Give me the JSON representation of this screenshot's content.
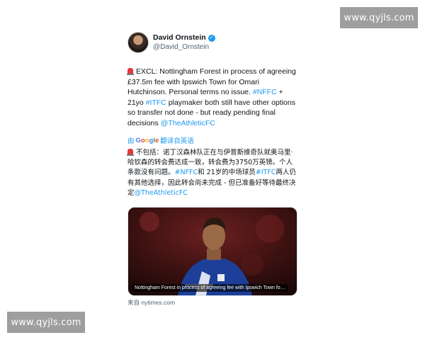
{
  "watermark": {
    "top_text": "www.qyjls.com",
    "bottom_text": "www.qyjls.com"
  },
  "tweet": {
    "author_name": "David Ornstein",
    "handle": "@David_Ornstein",
    "verified": true,
    "body_en": {
      "part1": "EXCL: Nottingham Forest in process of agreeing £37.5m fee with Ipswich Town for Omari Hutchinson. Personal terms no issue. ",
      "hashtag1": "#NFFC",
      "part2": " + 21yo ",
      "hashtag2": "#ITFC",
      "part3": " playmaker both still have other options so transfer not done - but ready pending final decisions ",
      "mention": "@TheAthleticFC"
    },
    "translate": {
      "prefix": "由",
      "google": [
        "G",
        "o",
        "o",
        "g",
        "l",
        "e"
      ],
      "suffix": "翻译自英语"
    },
    "body_zh": {
      "part1": "不包括：诺丁汉森林队正在与伊普斯维奇队就奥马里·哈钦森的转会费达成一致，转会费为3750万英镑。个人条款没有问题。",
      "hashtag1": "#NFFC",
      "part2": "和 21岁的中场球员",
      "hashtag2": "#ITFC",
      "part3": "两人仍有其他选择，因此转会尚未完成 - 但已准备好等待最终决定",
      "mention": "@TheAthleticFC"
    },
    "media": {
      "caption": "Nottingham Forest in process of agreeing fee with Ipswich Town for...",
      "source": "来自 nytimes.com"
    }
  },
  "colors": {
    "link": "#1d9bf0",
    "verified": "#1d9bf0",
    "text": "#0f1419",
    "muted": "#536471",
    "siren": "#e0393e"
  },
  "icons": [
    "verified-badge-icon",
    "siren-icon",
    "google-logo-icon"
  ]
}
